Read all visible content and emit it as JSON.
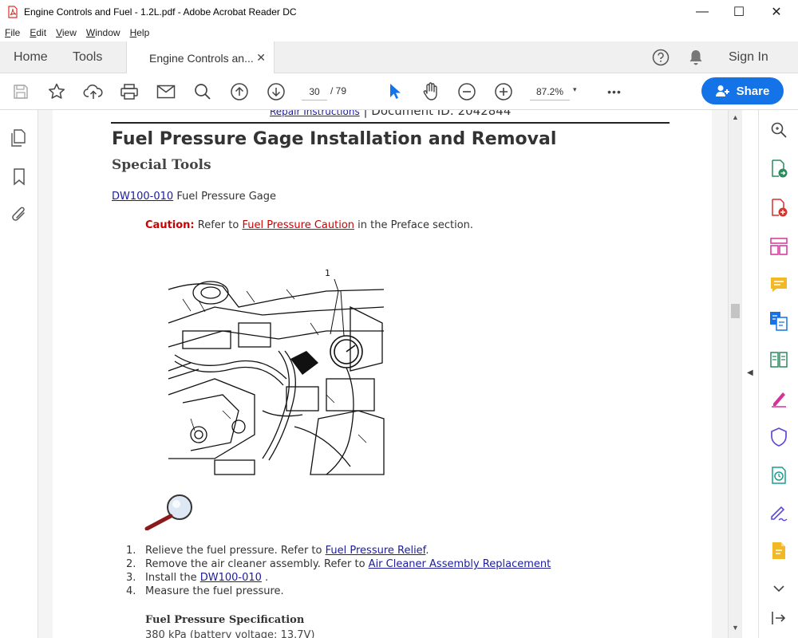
{
  "window": {
    "title": "Engine Controls and Fuel - 1.2L.pdf - Adobe Acrobat Reader DC",
    "minimize": "—",
    "maximize": "☐",
    "close": "✕"
  },
  "menu": {
    "items": [
      {
        "acc": "F",
        "rest": "ile"
      },
      {
        "acc": "E",
        "rest": "dit"
      },
      {
        "acc": "V",
        "rest": "iew"
      },
      {
        "acc": "W",
        "rest": "indow"
      },
      {
        "acc": "H",
        "rest": "elp"
      }
    ]
  },
  "tabs": {
    "home": "Home",
    "tools": "Tools",
    "document": "Engine Controls an...",
    "close": "✕",
    "sign_in": "Sign In"
  },
  "toolbar": {
    "page_current": "30",
    "page_total": "/  79",
    "zoom": "87.2%",
    "zoom_caret": "▾",
    "more": "•••",
    "share": "Share"
  },
  "doc": {
    "cut_header_link": "Repair Instructions",
    "cut_header_sep": " | Document ID: 2042844",
    "heading": "Fuel Pressure Gage Installation and Removal",
    "subheading": "Special Tools",
    "tool_link": "DW100-010",
    "tool_text": " Fuel Pressure Gage",
    "caution_label": "Caution:",
    "caution_text_1": " Refer to ",
    "caution_link": "Fuel Pressure Caution",
    "caution_text_2": " in the Preface section.",
    "figure_callout": "1",
    "steps": [
      {
        "num": "1.",
        "text": "Relieve the fuel pressure. Refer to ",
        "link": "Fuel Pressure Relief",
        "after": "."
      },
      {
        "num": "2.",
        "text": "Remove the air cleaner assembly. Refer to ",
        "link": "Air Cleaner Assembly Replacement",
        "after": ""
      },
      {
        "num": "3.",
        "text": "Install the ",
        "link": "DW100-010",
        "after": " ."
      },
      {
        "num": "4.",
        "text": "Measure the fuel pressure.",
        "link": "",
        "after": ""
      }
    ],
    "spec_heading": "Fuel Pressure Specification",
    "spec_cut": "380 kPa (battery voltage: 13.7V)"
  },
  "colors": {
    "accent": "#1473e6",
    "link": "#1c1c9c",
    "caution": "#cc0000",
    "pdf_red": "#d9312b"
  },
  "icons": {
    "left_rail": [
      "page-thumbnails-icon",
      "bookmark-icon",
      "attachment-icon"
    ],
    "right_rail": [
      "search-icon",
      "export-pdf-icon",
      "create-pdf-icon",
      "organize-pages-icon",
      "comment-icon",
      "combine-files-icon",
      "scan-ocr-icon",
      "fill-sign-icon",
      "protect-icon",
      "send-for-review-icon",
      "sign-icon",
      "more-tools-icon",
      "chevron-down-icon",
      "collapse-panel-icon"
    ]
  }
}
